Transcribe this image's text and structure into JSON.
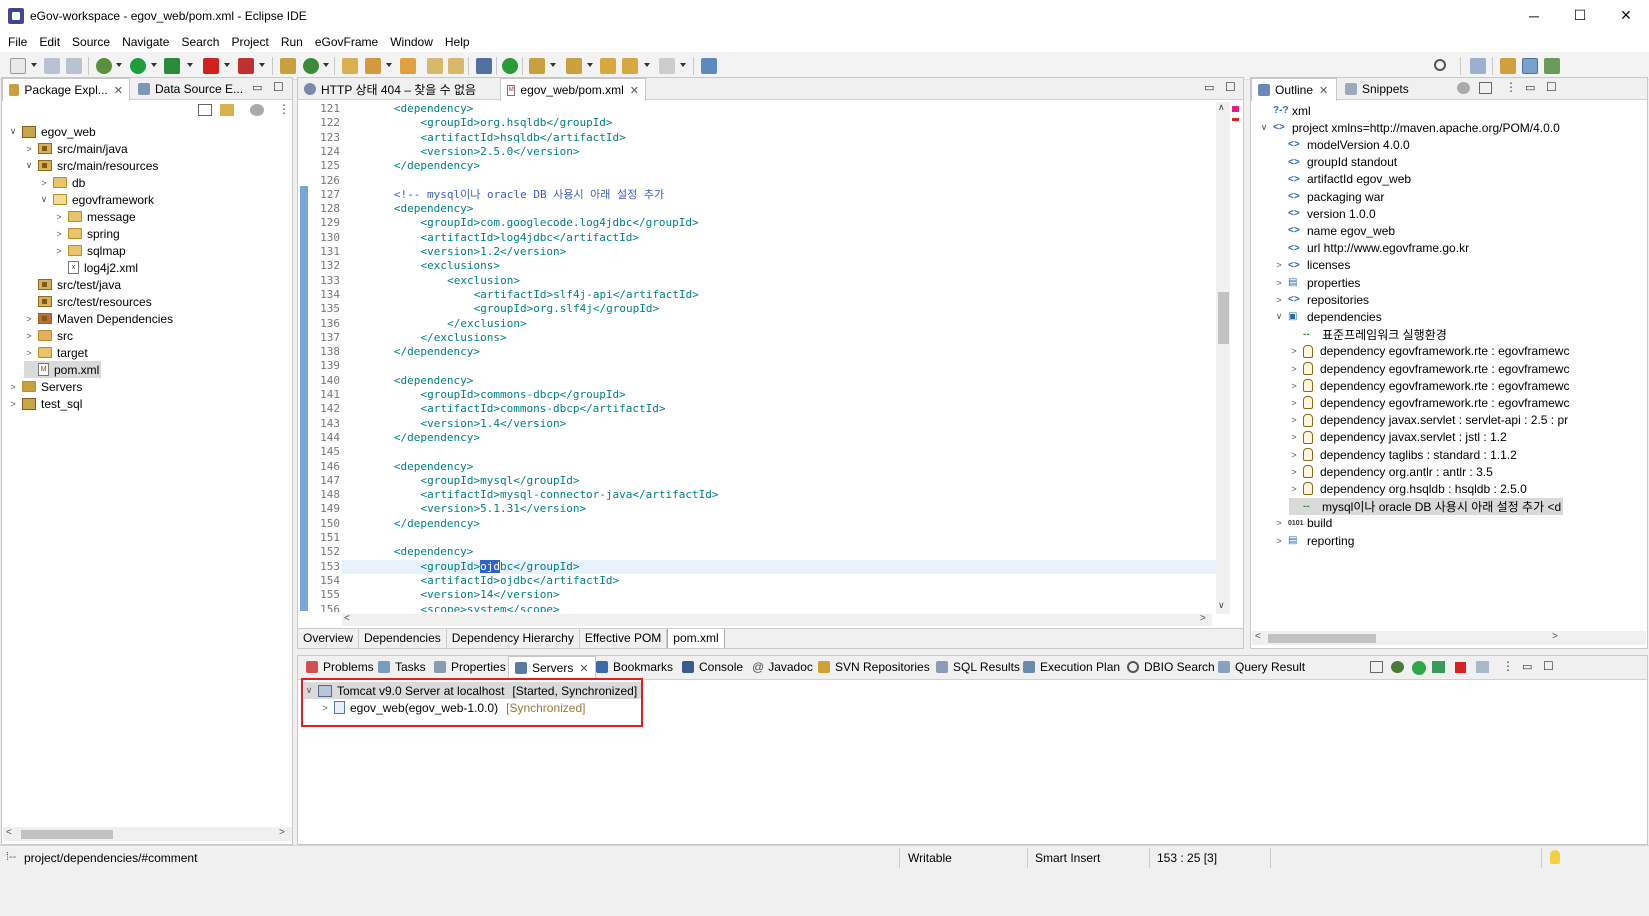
{
  "window": {
    "title": "eGov-workspace - egov_web/pom.xml - Eclipse IDE",
    "minimize": "─",
    "maximize": "☐",
    "close": "✕"
  },
  "menu": [
    "File",
    "Edit",
    "Source",
    "Navigate",
    "Search",
    "Project",
    "Run",
    "eGovFrame",
    "Window",
    "Help"
  ],
  "left_panel": {
    "tabs": [
      {
        "label": "Package Expl...",
        "close": "✕"
      },
      {
        "label": "Data Source E...",
        "close": ""
      }
    ],
    "tree": [
      {
        "label": "egov_web",
        "chev": "∨"
      },
      {
        "label": "src/main/java",
        "chev": ">"
      },
      {
        "label": "src/main/resources",
        "chev": "∨"
      },
      {
        "label": "db",
        "chev": ">"
      },
      {
        "label": "egovframework",
        "chev": "∨"
      },
      {
        "label": "message",
        "chev": ">"
      },
      {
        "label": "spring",
        "chev": ">"
      },
      {
        "label": "sqlmap",
        "chev": ">"
      },
      {
        "label": "log4j2.xml",
        "chev": ""
      },
      {
        "label": "src/test/java",
        "chev": ""
      },
      {
        "label": "src/test/resources",
        "chev": ""
      },
      {
        "label": "Maven Dependencies",
        "chev": ">"
      },
      {
        "label": "src",
        "chev": ">"
      },
      {
        "label": "target",
        "chev": ">"
      },
      {
        "label": "pom.xml",
        "chev": ""
      },
      {
        "label": "Servers",
        "chev": ">"
      },
      {
        "label": "test_sql",
        "chev": ">"
      }
    ]
  },
  "editor": {
    "tabs": [
      {
        "label": "HTTP 상태 404 – 찾을 수 없음",
        "close": ""
      },
      {
        "label": "egov_web/pom.xml",
        "close": "✕"
      }
    ],
    "lines": [
      {
        "n": "121",
        "indent": 6,
        "text": "<dependency>"
      },
      {
        "n": "122",
        "indent": 10,
        "text": "<groupId>org.hsqldb</groupId>"
      },
      {
        "n": "123",
        "indent": 10,
        "text": "<artifactId>hsqldb</artifactId>"
      },
      {
        "n": "124",
        "indent": 10,
        "text": "<version>2.5.0</version>"
      },
      {
        "n": "125",
        "indent": 6,
        "text": "</dependency>"
      },
      {
        "n": "126",
        "indent": 0,
        "text": ""
      },
      {
        "n": "127",
        "indent": 6,
        "text": "<!-- mysql이나 oracle DB 사용시 아래 설정 추가"
      },
      {
        "n": "128",
        "indent": 6,
        "text": "<dependency>"
      },
      {
        "n": "129",
        "indent": 10,
        "text": "<groupId>com.googlecode.log4jdbc</groupId>"
      },
      {
        "n": "130",
        "indent": 10,
        "text": "<artifactId>log4jdbc</artifactId>"
      },
      {
        "n": "131",
        "indent": 10,
        "text": "<version>1.2</version>"
      },
      {
        "n": "132",
        "indent": 10,
        "text": "<exclusions>"
      },
      {
        "n": "133",
        "indent": 14,
        "text": "<exclusion>"
      },
      {
        "n": "134",
        "indent": 18,
        "text": "<artifactId>slf4j-api</artifactId>"
      },
      {
        "n": "135",
        "indent": 18,
        "text": "<groupId>org.slf4j</groupId>"
      },
      {
        "n": "136",
        "indent": 14,
        "text": "</exclusion>"
      },
      {
        "n": "137",
        "indent": 10,
        "text": "</exclusions>"
      },
      {
        "n": "138",
        "indent": 6,
        "text": "</dependency>"
      },
      {
        "n": "139",
        "indent": 0,
        "text": ""
      },
      {
        "n": "140",
        "indent": 6,
        "text": "<dependency>"
      },
      {
        "n": "141",
        "indent": 10,
        "text": "<groupId>commons-dbcp</groupId>"
      },
      {
        "n": "142",
        "indent": 10,
        "text": "<artifactId>commons-dbcp</artifactId>"
      },
      {
        "n": "143",
        "indent": 10,
        "text": "<version>1.4</version>"
      },
      {
        "n": "144",
        "indent": 6,
        "text": "</dependency>"
      },
      {
        "n": "145",
        "indent": 0,
        "text": ""
      },
      {
        "n": "146",
        "indent": 6,
        "text": "<dependency>"
      },
      {
        "n": "147",
        "indent": 10,
        "text": "<groupId>mysql</groupId>"
      },
      {
        "n": "148",
        "indent": 10,
        "text": "<artifactId>mysql-connector-java</artifactId>"
      },
      {
        "n": "149",
        "indent": 10,
        "text": "<version>5.1.31</version>"
      },
      {
        "n": "150",
        "indent": 6,
        "text": "</dependency>"
      },
      {
        "n": "151",
        "indent": 0,
        "text": ""
      },
      {
        "n": "152",
        "indent": 6,
        "text": "<dependency>"
      },
      {
        "n": "153",
        "indent": 10,
        "text": "<groupId>ojdbc</groupId>"
      },
      {
        "n": "154",
        "indent": 10,
        "text": "<artifactId>ojdbc</artifactId>"
      },
      {
        "n": "155",
        "indent": 10,
        "text": "<version>14</version>"
      },
      {
        "n": "156",
        "indent": 10,
        "text": "<scope>system</scope>"
      }
    ],
    "bottom_tabs": [
      "Overview",
      "Dependencies",
      "Dependency Hierarchy",
      "Effective POM",
      "pom.xml"
    ],
    "active_bottom_tab": "pom.xml"
  },
  "outline": {
    "tabs": [
      {
        "label": "Outline",
        "close": "✕"
      },
      {
        "label": "Snippets",
        "close": ""
      }
    ],
    "rows": [
      {
        "level": 0,
        "chev": "",
        "icon": "?-?",
        "label": "xml"
      },
      {
        "level": 0,
        "chev": "∨",
        "icon": "<>",
        "label": "project xmlns=http://maven.apache.org/POM/4.0.0"
      },
      {
        "level": 1,
        "chev": "",
        "icon": "<>",
        "label": "modelVersion  4.0.0"
      },
      {
        "level": 1,
        "chev": "",
        "icon": "<>",
        "label": "groupId  standout"
      },
      {
        "level": 1,
        "chev": "",
        "icon": "<>",
        "label": "artifactId  egov_web"
      },
      {
        "level": 1,
        "chev": "",
        "icon": "<>",
        "label": "packaging  war"
      },
      {
        "level": 1,
        "chev": "",
        "icon": "<>",
        "label": "version  1.0.0"
      },
      {
        "level": 1,
        "chev": "",
        "icon": "<>",
        "label": "name  egov_web"
      },
      {
        "level": 1,
        "chev": "",
        "icon": "<>",
        "label": "url  http://www.egovframe.go.kr"
      },
      {
        "level": 1,
        "chev": ">",
        "icon": "<>",
        "label": "licenses"
      },
      {
        "level": 1,
        "chev": ">",
        "icon": "▤",
        "label": "properties"
      },
      {
        "level": 1,
        "chev": ">",
        "icon": "<>",
        "label": "repositories"
      },
      {
        "level": 1,
        "chev": "∨",
        "icon": "▣",
        "label": "dependencies"
      },
      {
        "level": 2,
        "chev": "",
        "icon": "--",
        "label": "표준프레임워크 실행환경"
      },
      {
        "level": 2,
        "chev": ">",
        "icon": "dep",
        "label": "dependency  egovframework.rte : egovframewc"
      },
      {
        "level": 2,
        "chev": ">",
        "icon": "dep",
        "label": "dependency  egovframework.rte : egovframewc"
      },
      {
        "level": 2,
        "chev": ">",
        "icon": "dep",
        "label": "dependency  egovframework.rte : egovframewc"
      },
      {
        "level": 2,
        "chev": ">",
        "icon": "dep",
        "label": "dependency  egovframework.rte : egovframewc"
      },
      {
        "level": 2,
        "chev": ">",
        "icon": "dep",
        "label": "dependency  javax.servlet : servlet-api : 2.5 : pr"
      },
      {
        "level": 2,
        "chev": ">",
        "icon": "dep",
        "label": "dependency  javax.servlet : jstl : 1.2"
      },
      {
        "level": 2,
        "chev": ">",
        "icon": "dep",
        "label": "dependency  taglibs : standard : 1.1.2"
      },
      {
        "level": 2,
        "chev": ">",
        "icon": "dep",
        "label": "dependency  org.antlr : antlr : 3.5"
      },
      {
        "level": 2,
        "chev": ">",
        "icon": "dep",
        "label": "dependency  org.hsqldb : hsqldb : 2.5.0"
      },
      {
        "level": 2,
        "chev": "",
        "icon": "--",
        "label": "mysql이나 oracle DB 사용시 아래 설정 추가 <d"
      },
      {
        "level": 1,
        "chev": ">",
        "icon": "0101",
        "label": "build"
      },
      {
        "level": 1,
        "chev": ">",
        "icon": "▤",
        "label": "reporting"
      }
    ]
  },
  "bottom_panel": {
    "tabs": [
      {
        "label": "Problems",
        "close": ""
      },
      {
        "label": "Tasks",
        "close": ""
      },
      {
        "label": "Properties",
        "close": ""
      },
      {
        "label": "Servers",
        "close": "✕"
      },
      {
        "label": "Bookmarks",
        "close": ""
      },
      {
        "label": "Console",
        "close": ""
      },
      {
        "label": "Javadoc",
        "close": ""
      },
      {
        "label": "SVN Repositories",
        "close": ""
      },
      {
        "label": "SQL Results",
        "close": ""
      },
      {
        "label": "Execution Plan",
        "close": ""
      },
      {
        "label": "DBIO Search",
        "close": ""
      },
      {
        "label": "Query Result",
        "close": ""
      }
    ],
    "servers": {
      "server_label": "Tomcat v9.0 Server at localhost",
      "server_state": "[Started, Synchronized]",
      "module_label": "egov_web(egov_web-1.0.0)",
      "module_state": "[Synchronized]"
    }
  },
  "status": {
    "path": "project/dependencies/#comment",
    "writable": "Writable",
    "insert_mode": "Smart Insert",
    "position": "153 : 25 [3]"
  },
  "colors": {
    "highlight_box": "#e02020",
    "xml_tag": "#008080",
    "comment": "#3f5fbf",
    "selection": "#2f65ca"
  }
}
